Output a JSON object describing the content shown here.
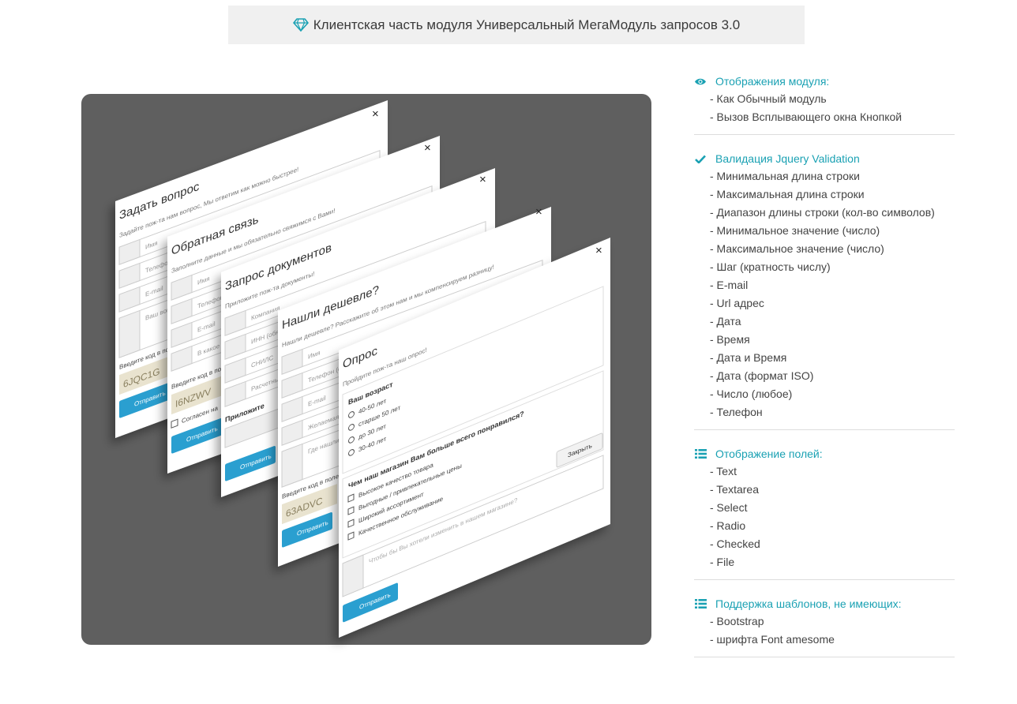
{
  "header": {
    "title": "Клиентская часть модуля Универсальный МегаМодуль запросов 3.0",
    "icon": "diamond-icon",
    "accent": "#1aa1b3"
  },
  "colors": {
    "accent": "#1aa1b3",
    "stage_bg": "#5f5f5f",
    "button": "#2a9fd0"
  },
  "forms": [
    {
      "title": "Задать вопрос",
      "subtitle": "Задайте пож-та нам вопрос, Мы ответим как можно быстрее!",
      "fields": [
        "Имя",
        "Телефон",
        "E-mail",
        "Ваш вопрос"
      ],
      "captcha_label": "Введите код в поле",
      "captcha": "6JQC1G",
      "submit": "Отправить"
    },
    {
      "title": "Обратная связь",
      "subtitle": "Заполните данные и мы обязательно свяжимся с Вами!",
      "fields": [
        "Имя",
        "Телефон",
        "E-mail",
        "В какое время"
      ],
      "captcha_label": "Введите код в поле",
      "captcha": "I6NZWV",
      "agree": "Согласен на",
      "submit": "Отправить"
    },
    {
      "title": "Запрос документов",
      "subtitle": "Приложите пож-та документы!",
      "fields": [
        "Компания",
        "ИНН (обяз)",
        "СНИЛС",
        "Расчетный"
      ],
      "attach": "Приложите",
      "submit": "Отправить"
    },
    {
      "title": "Нашли дешевле?",
      "subtitle": "Нашли дешевле? Расскажите об этом нам и мы компенсируем разницу!",
      "fields": [
        "Имя",
        "Телефон (обяз)",
        "E-mail",
        "Желаемая",
        "Где нашли"
      ],
      "captcha_label": "Введите код в поле",
      "captcha": "63ADVC",
      "submit": "Отправить"
    },
    {
      "title": "Опрос",
      "subtitle": "Пройдите пож-та наш опрос!",
      "q1": "Ваш возраст",
      "q1_options": [
        "40-50 лет",
        "старше 50 лет",
        "до 30 лет",
        "30-40 лет"
      ],
      "q2": "Чем наш магазин Вам больше всего понравился?",
      "q2_options": [
        "Высокое качество товара",
        "Выгодные / привлекательные цены",
        "Широкий ассортимент",
        "Качественное обслуживание"
      ],
      "textarea": "Чтобы бы Вы хотели изменить в нашем магазине?",
      "close": "Закрыть",
      "submit": "Отправить"
    }
  ],
  "panel": {
    "sections": [
      {
        "icon": "eye-icon",
        "title": "Отображения модуля:",
        "items": [
          "- Как Обычный модуль",
          "- Вызов Всплывающего окна Кнопкой"
        ]
      },
      {
        "icon": "check-icon",
        "title": "Валидация Jquery Validation",
        "items": [
          "- Минимальная длина строки",
          "- Максимальная длина строки",
          "- Диапазон длины строки (кол-во символов)",
          "- Минимальное значение (число)",
          "- Максимальное значение (число)",
          "- Шаг (кратность числу)",
          "- E-mail",
          "- Url адрес",
          "- Дата",
          "- Время",
          "- Дата и Время",
          "- Дата (формат ISO)",
          "- Число (любое)",
          "- Телефон"
        ]
      },
      {
        "icon": "list-icon",
        "title": "Отображение полей:",
        "items": [
          "- Text",
          "- Textarea",
          "- Select",
          "- Radio",
          "- Checked",
          "- File"
        ]
      },
      {
        "icon": "list-icon",
        "title": "Поддержка шаблонов, не имеющих:",
        "items": [
          "- Bootstrap",
          "- шрифта Font amesome"
        ]
      }
    ]
  }
}
